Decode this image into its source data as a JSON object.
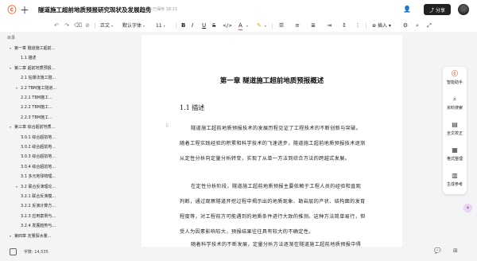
{
  "header": {
    "title": "隧道施工超前地质预报研究现状及发展趋势",
    "saved_status": "已保存 18:21",
    "share_label": "分享"
  },
  "toolbar": {
    "style_select": "正文",
    "font_select": "默认字体",
    "size_select": "11",
    "insert_label": "插入"
  },
  "sidebar": {
    "heading": "目录",
    "items": [
      {
        "label": "第一章 隧道施工超前..."
      },
      {
        "label": "1.1 描述"
      },
      {
        "label": "第二章 超前地质预报..."
      },
      {
        "label": "2.1 钻爆法施工隧..."
      },
      {
        "label": "2.2 TBM施工隧道..."
      },
      {
        "label": "2.2.1 TBM施工..."
      },
      {
        "label": "2.2.2 TBM施工..."
      },
      {
        "label": "2.2.3 TBM施工..."
      },
      {
        "label": "第三章 综合超前地质..."
      },
      {
        "label": "3.0.1 综合超前地..."
      },
      {
        "label": "3.0.2 综合超前地..."
      },
      {
        "label": "3.0.3 综合超前地..."
      },
      {
        "label": "3.0.4 综合超前地..."
      },
      {
        "label": "3.1 多元地球物理..."
      },
      {
        "label": "3.2 联合反演理论..."
      },
      {
        "label": "3.2.1 联合反演模..."
      },
      {
        "label": "3.2.2 反演计算方..."
      },
      {
        "label": "3.2.3 应用案例与..."
      },
      {
        "label": "3.2.4 发展趋势与..."
      },
      {
        "label": "第四章 定量探水量..."
      }
    ],
    "word_count": "字数: 14,535"
  },
  "document": {
    "chapter_title": "第一章 隧道施工超前地质预报概述",
    "section_title": "1.1 描述",
    "paragraphs": [
      "隧道施工超前地质预报技术的发展历程见证了工程技术的不断创新与突破。随着工程实践经验的积累和科学技术的飞速进步，隧道施工超前地质预报技术逐渐从定性分析向定量分析转变，实现了从单一方法到综合方法的跨越式发展。",
      "在定性分析阶段，隧道施工超前地质预报主要依赖于工程人员的经验和直观判断，通过观察隧道开挖过程中揭示出的地质现象、勘岩层的产状、结构面的发育程度等，对工程前方可能遇到的地质条件进行大致的推测。这种方法简单易行，但受人为因素影响较大，预报结果往往具有较大的不确定性。",
      "随着科学技术的不断发展，定量分析方法逐渐在隧道施工超前地质预报中得到应用。通过采用各种地球物理探测方法和技术手段，如地质雷达、瞬变电磁等"
    ]
  },
  "right_panel": {
    "items": [
      {
        "label": "智能助手",
        "icon": "smart-assistant-icon"
      },
      {
        "label": "资料搜索",
        "icon": "search-icon"
      },
      {
        "label": "全文校正",
        "icon": "proofread-icon"
      },
      {
        "label": "格式整理",
        "icon": "format-icon"
      },
      {
        "label": "生成参考",
        "icon": "reference-chart-icon"
      }
    ]
  },
  "colors": {
    "brand": "#f05a28",
    "share_bg": "#222222",
    "sidebar_bg": "#f3f4f6"
  }
}
